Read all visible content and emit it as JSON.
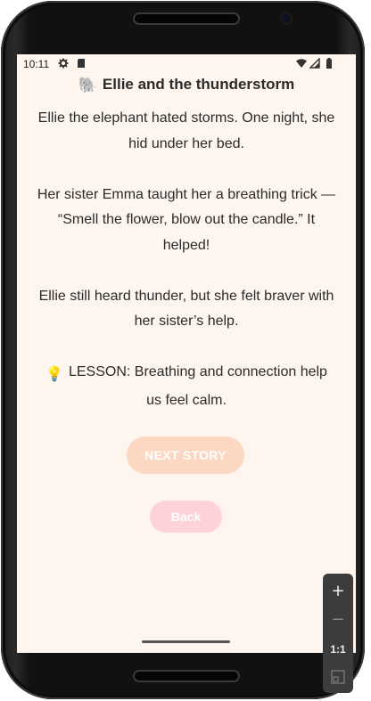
{
  "status_bar": {
    "time": "10:11",
    "left_icons": [
      "gear-icon",
      "sd-card-icon"
    ],
    "right_icons": [
      "wifi-icon",
      "signal-icon",
      "battery-icon"
    ]
  },
  "story": {
    "title_emoji": "🐘",
    "title": "Ellie and the thunderstorm",
    "paragraphs": [
      "Ellie the elephant hated storms. One night, she hid under her bed.",
      "Her sister Emma taught her a breathing trick — “Smell the flower, blow out the candle.” It helped!",
      "Ellie still heard thunder, but she felt braver with her sister’s help."
    ],
    "lesson_icon": "💡",
    "lesson": "LESSON: Breathing and connection help us feel calm."
  },
  "buttons": {
    "next_story": "NEXT STORY",
    "back": "Back"
  },
  "emulator_zoom": {
    "zoom_in": "+",
    "zoom_out": "−",
    "actual_size": "1:1"
  },
  "colors": {
    "screen_background": "#fdf5ee",
    "next_button": "#fcd8c3",
    "back_button": "#fdd3d8",
    "text": "#2b2b2b"
  }
}
